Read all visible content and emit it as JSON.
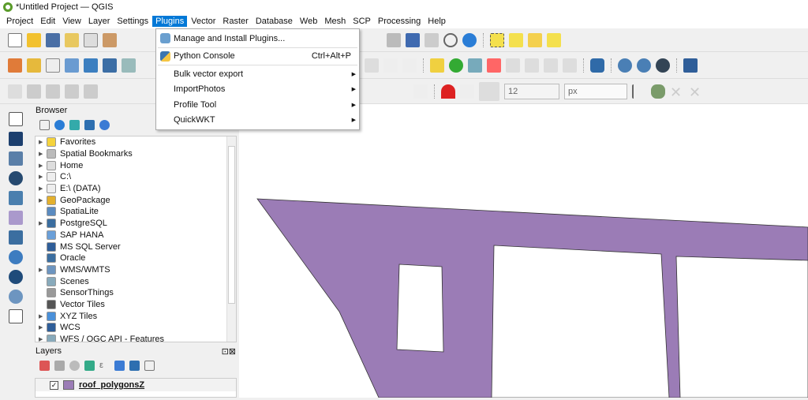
{
  "window": {
    "title": "*Untitled Project — QGIS"
  },
  "menubar": [
    "Project",
    "Edit",
    "View",
    "Layer",
    "Settings",
    "Plugins",
    "Vector",
    "Raster",
    "Database",
    "Web",
    "Mesh",
    "SCP",
    "Processing",
    "Help"
  ],
  "plugins_menu": [
    {
      "label": "Manage and Install Plugins...",
      "icon": "plugins-icon"
    },
    {
      "label": "Python Console",
      "shortcut": "Ctrl+Alt+P",
      "icon": "python-icon"
    },
    {
      "label": "Bulk vector export",
      "submenu": true
    },
    {
      "label": "ImportPhotos",
      "submenu": true
    },
    {
      "label": "Profile Tool",
      "submenu": true
    },
    {
      "label": "QuickWKT",
      "submenu": true
    }
  ],
  "snapping": {
    "tolerance": "12",
    "unit": "px"
  },
  "browser": {
    "title": "Browser",
    "items": [
      "Favorites",
      "Spatial Bookmarks",
      "Home",
      "C:\\",
      "E:\\ (DATA)",
      "GeoPackage",
      "SpatiaLite",
      "PostgreSQL",
      "SAP HANA",
      "MS SQL Server",
      "Oracle",
      "WMS/WMTS",
      "Scenes",
      "SensorThings",
      "Vector Tiles",
      "XYZ Tiles",
      "WCS",
      "WFS / OGC API - Features"
    ]
  },
  "layers": {
    "title": "Layers",
    "items": [
      {
        "name": "roof_polygonsZ",
        "checked": true,
        "color": "#9b7cb6"
      }
    ]
  },
  "colors": {
    "accent": "#0078d7",
    "polygon": "#9b7cb6"
  }
}
